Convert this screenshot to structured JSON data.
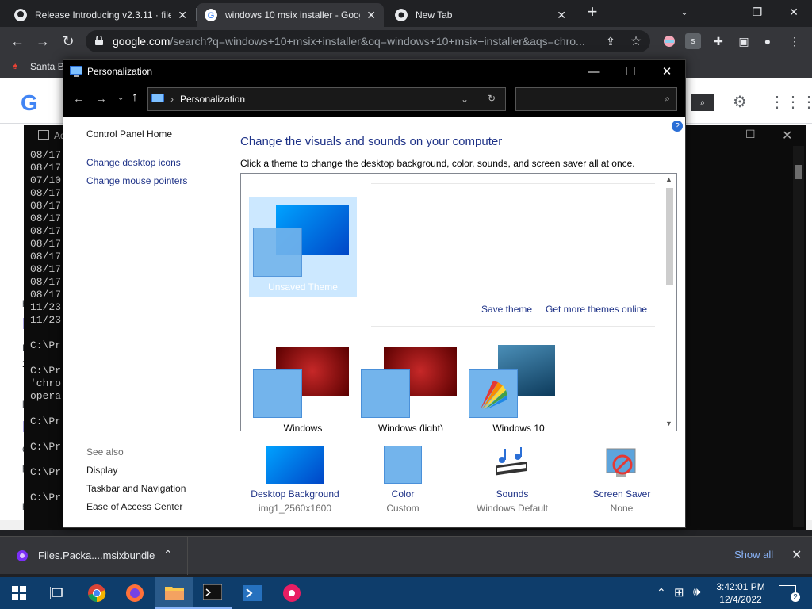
{
  "browser": {
    "tabs": [
      {
        "label": "Release Introducing v2.3.11 · files",
        "icon": "github-icon"
      },
      {
        "label": "windows 10 msix installer - Google",
        "icon": "google-icon"
      },
      {
        "label": "New Tab",
        "icon": "chrome-icon"
      }
    ],
    "url_domain": "google.com",
    "url_rest": "/search?q=windows+10+msix+installer&oq=windows+10+msix+installer&aqs=chro...",
    "bookmark_label": "Santa B"
  },
  "terminal": {
    "title_short": "Ad",
    "lines": [
      "08/17",
      "08/17",
      "07/10",
      "08/17",
      "08/17",
      "08/17",
      "08/17",
      "08/17",
      "08/17",
      "08/17",
      "08/17",
      "08/17",
      "11/23",
      "11/23",
      "",
      "C:\\Pr",
      "",
      "C:\\Pr",
      "'chro",
      "opera",
      "",
      "C:\\Pr",
      "",
      "C:\\Pr",
      "",
      "C:\\Pr",
      "",
      "C:\\Pr"
    ]
  },
  "google_page_fragments": [
    "ht",
    "M",
    "Fo",
    "10",
    "ht",
    "D",
    "O",
    "pi",
    "ht"
  ],
  "window": {
    "title": "Personalization",
    "breadcrumb": "Personalization",
    "left_nav": {
      "home": "Control Panel Home",
      "links": [
        "Change desktop icons",
        "Change mouse pointers"
      ],
      "see_also_title": "See also",
      "see_also": [
        "Display",
        "Taskbar and Navigation",
        "Ease of Access Center"
      ]
    },
    "heading": "Change the visuals and sounds on your computer",
    "subheading": "Click a theme to change the desktop background, color, sounds, and screen saver all at once.",
    "actions": {
      "save": "Save theme",
      "more": "Get more themes online"
    },
    "themes": [
      {
        "caption": "Unsaved Theme",
        "selected": true
      },
      {
        "caption": "Windows",
        "selected": false
      },
      {
        "caption": "Windows (light)",
        "selected": false
      },
      {
        "caption": "Windows 10",
        "selected": false
      }
    ],
    "bottom": [
      {
        "label": "Desktop Background",
        "value": "img1_2560x1600"
      },
      {
        "label": "Color",
        "value": "Custom"
      },
      {
        "label": "Sounds",
        "value": "Windows Default"
      },
      {
        "label": "Screen Saver",
        "value": "None"
      }
    ]
  },
  "download": {
    "file": "Files.Packa....msixbundle",
    "show_all": "Show all"
  },
  "taskbar": {
    "time": "3:42:01 PM",
    "date": "12/4/2022",
    "notifications": "2"
  },
  "colors": {
    "accent_blue": "#1e3287",
    "selection": "#cce8ff",
    "taskbar": "#0e3d6b"
  }
}
